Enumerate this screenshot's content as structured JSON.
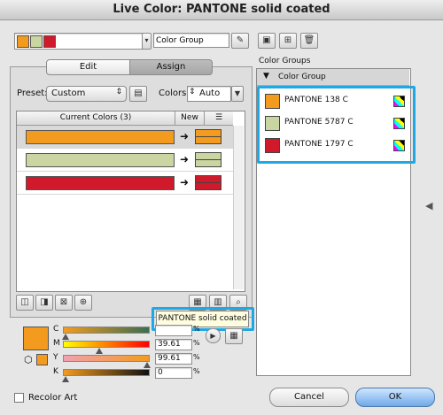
{
  "window": {
    "title": "Live Color: PANTONE solid coated"
  },
  "top": {
    "group_name_value": "Color Group",
    "swatch_colors": [
      "#f29b1f",
      "#c9d6a1",
      "#d0192a"
    ]
  },
  "tabs": [
    {
      "label": "Edit"
    },
    {
      "label": "Assign"
    }
  ],
  "preset": {
    "label": "Preset:",
    "value": "Custom"
  },
  "colors": {
    "label": "Colors:",
    "value": "Auto"
  },
  "table": {
    "headers": {
      "current": "Current Colors (3)",
      "new": "New"
    },
    "rows": [
      {
        "current": "#f29b1f",
        "new": "#f29b1f"
      },
      {
        "current": "#c9d6a1",
        "new": "#c9d6a1"
      },
      {
        "current": "#d0192a",
        "new": "#d0192a"
      }
    ]
  },
  "library_label": "PANTONE solid coated",
  "cmyk": {
    "c": {
      "label": "C",
      "value": "",
      "unit": "%",
      "fraction": 0.0
    },
    "m": {
      "label": "M",
      "value": "39.61",
      "unit": "%",
      "fraction": 0.3961
    },
    "y": {
      "label": "Y",
      "value": "99.61",
      "unit": "%",
      "fraction": 0.9961
    },
    "k": {
      "label": "K",
      "value": "0",
      "unit": "%",
      "fraction": 0.0
    }
  },
  "color_groups": {
    "title": "Color Groups",
    "group_name": "Color Group",
    "items": [
      {
        "name": "PANTONE 138 C",
        "color": "#f29b1f"
      },
      {
        "name": "PANTONE 5787 C",
        "color": "#c9d6a1"
      },
      {
        "name": "PANTONE 1797 C",
        "color": "#d0192a"
      }
    ]
  },
  "footer": {
    "recolor_art": "Recolor Art",
    "cancel": "Cancel",
    "ok": "OK"
  },
  "accent": "#1fa8e6"
}
